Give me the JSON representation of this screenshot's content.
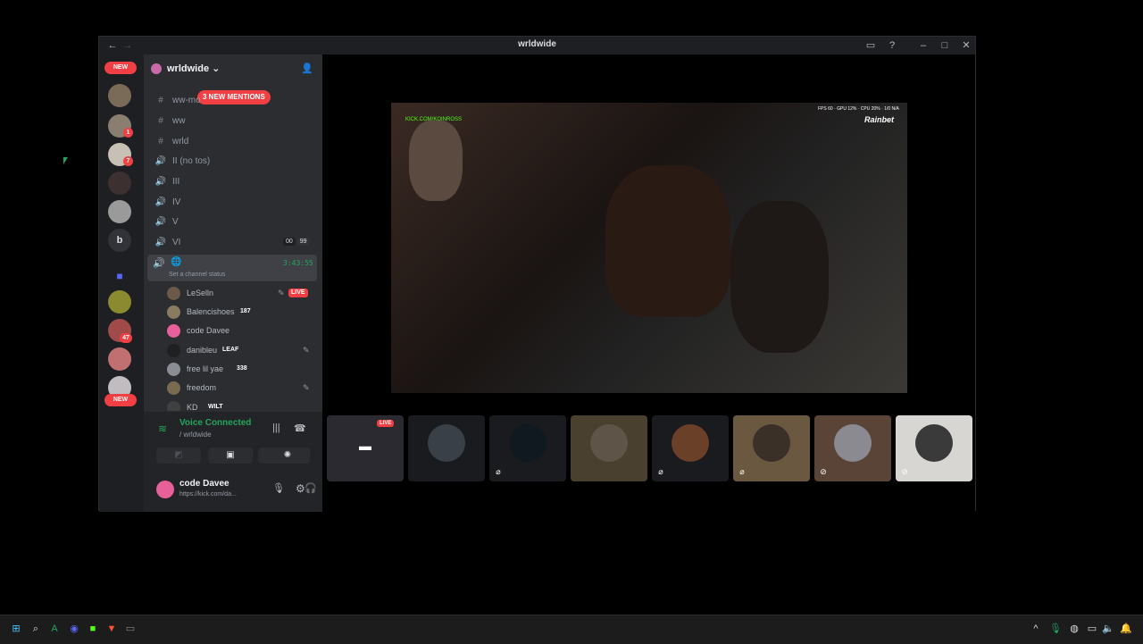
{
  "window": {
    "title": "wrldwide"
  },
  "rail": {
    "new_top": "NEW",
    "new_bottom": "NEW",
    "badges": [
      "1",
      "7",
      "47"
    ],
    "letter_server": "b"
  },
  "server": {
    "name": "wrldwide",
    "new_mentions": "3 NEW MENTIONS"
  },
  "channels": [
    {
      "icon": "#",
      "name": "ww-mo"
    },
    {
      "icon": "#",
      "name": "ww"
    },
    {
      "icon": "#",
      "name": "wrld"
    },
    {
      "icon": "🔊",
      "name": "II (no tos)"
    },
    {
      "icon": "🔊",
      "name": "III"
    },
    {
      "icon": "🔊",
      "name": "IV"
    },
    {
      "icon": "🔊",
      "name": "V"
    },
    {
      "icon": "🔊",
      "name": "VI"
    }
  ],
  "vi_counts": {
    "a": "00",
    "b": "99"
  },
  "active_channel": {
    "timer": "3:43:55",
    "status": "Set a channel status"
  },
  "voice_users": [
    {
      "name": "LeSelln",
      "tag": "LIVE"
    },
    {
      "name": "Balencishoes",
      "tag": "187"
    },
    {
      "name": "code Davee",
      "tag": ""
    },
    {
      "name": "danibleu",
      "tag": "LEAF"
    },
    {
      "name": "free lil yae",
      "tag": "338"
    },
    {
      "name": "freedom",
      "tag": ""
    },
    {
      "name": "KD",
      "tag": "WILT"
    }
  ],
  "voice_panel": {
    "status": "Voice Connected",
    "location": "/ wrldwide"
  },
  "user_panel": {
    "name": "code Davee",
    "status": "https://kick.com/da..."
  },
  "stream": {
    "overlay_url": "KICK.COM/KOINROSS",
    "overlay_stats": "FPS 60 · GPU 12% · CPU 20% · 1/0 N/A",
    "brand": "Rainbet",
    "live": "LIVE"
  },
  "colors": {
    "accent_green": "#23a55a",
    "red": "#f23f43",
    "blurple": "#5865f2"
  }
}
